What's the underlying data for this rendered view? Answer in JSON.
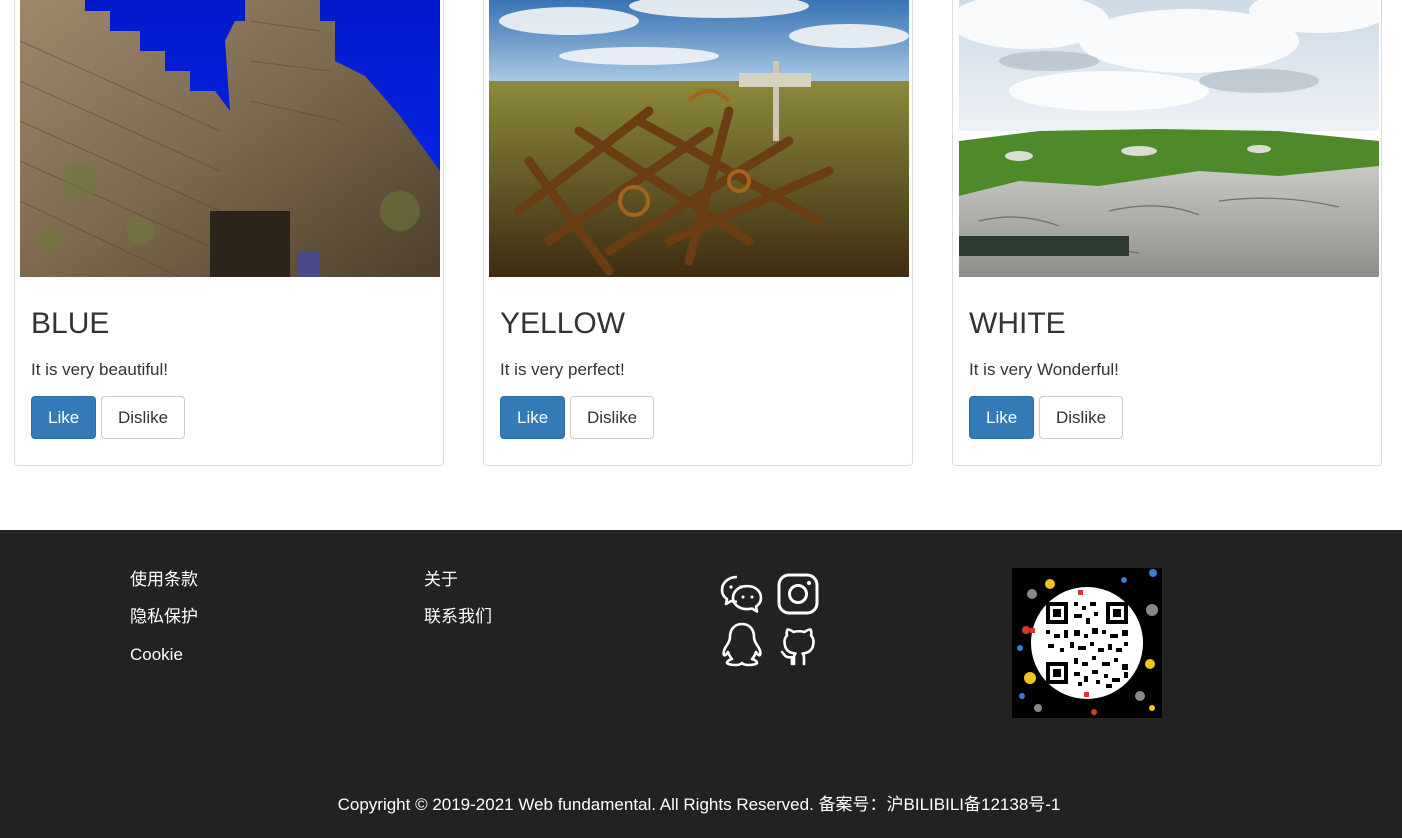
{
  "cards": [
    {
      "title": "BLUE",
      "text": "It is very beautiful!",
      "like_label": "Like",
      "dislike_label": "Dislike",
      "image": "castle-wall-photo"
    },
    {
      "title": "YELLOW",
      "text": "It is very perfect!",
      "like_label": "Like",
      "dislike_label": "Dislike",
      "image": "rusty-anchors-field-photo"
    },
    {
      "title": "WHITE",
      "text": "It is very Wonderful!",
      "like_label": "Like",
      "dislike_label": "Dislike",
      "image": "rocky-coast-clouds-photo"
    }
  ],
  "footer": {
    "links_col1": [
      "使用条款",
      "隐私保护",
      "Cookie"
    ],
    "links_col2": [
      "关于",
      "联系我们"
    ],
    "social_icons": [
      "wechat-icon",
      "instagram-icon",
      "qq-icon",
      "github-icon"
    ],
    "qr_code": "qr-code-image",
    "copyright": "Copyright © 2019-2021 Web fundamental. All Rights Reserved. 备案号：沪BILIBILI备12138号-1"
  },
  "colors": {
    "primary_button": "#337ab7",
    "footer_bg": "#222222",
    "card_border": "#dddddd"
  }
}
